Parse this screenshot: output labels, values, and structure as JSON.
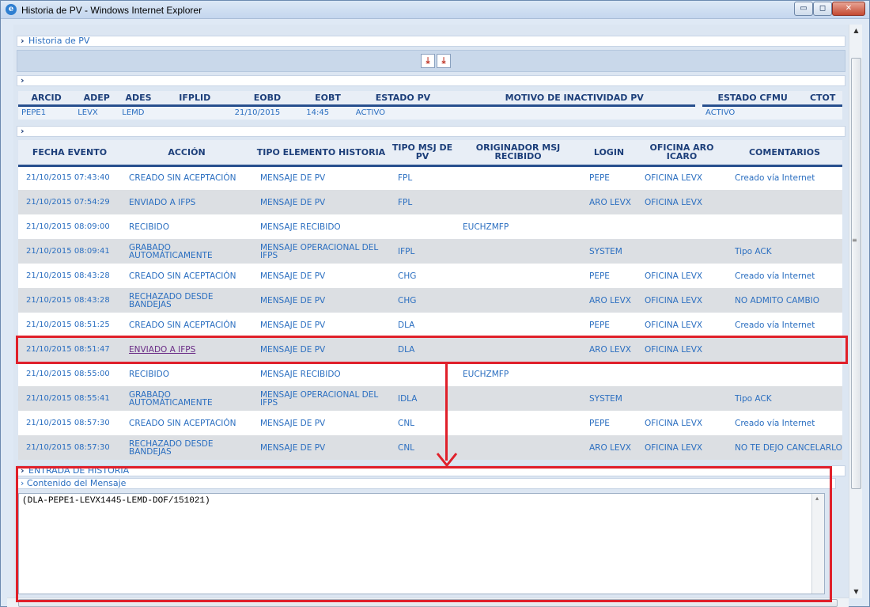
{
  "window": {
    "title": "Historia de PV - Windows Internet Explorer",
    "ie_icon": "ie-logo-icon",
    "controls": {
      "minimize": "▭",
      "maximize": "◻",
      "close": "✕"
    }
  },
  "sections": {
    "historia": "Historia de PV",
    "bullet": "›"
  },
  "pv": {
    "headers": [
      "ARCID",
      "ADEP",
      "ADES",
      "IFPLID",
      "EOBD",
      "EOBT",
      "ESTADO PV",
      "MOTIVO DE INACTIVIDAD PV",
      "ESTADO CFMU",
      "CTOT"
    ],
    "row": [
      "PEPE1",
      "LEVX",
      "LEMD",
      "",
      "21/10/2015",
      "14:45",
      "ACTIVO",
      "",
      "ACTIVO",
      ""
    ]
  },
  "history": {
    "headers": [
      "FECHA EVENTO",
      "ACCIÓN",
      "TIPO ELEMENTO HISTORIA",
      "TIPO MSJ DE PV",
      "ORIGINADOR MSJ RECIBIDO",
      "LOGIN",
      "OFICINA ARO ICARO",
      "COMENTARIOS"
    ],
    "rows": [
      [
        "21/10/2015 07:43:40",
        "CREADO SIN ACEPTACIÓN",
        "MENSAJE DE PV",
        "FPL",
        "",
        "PEPE",
        "OFICINA LEVX",
        "Creado vía Internet"
      ],
      [
        "21/10/2015 07:54:29",
        "ENVIADO A IFPS",
        "MENSAJE DE PV",
        "FPL",
        "",
        "ARO LEVX",
        "OFICINA LEVX",
        ""
      ],
      [
        "21/10/2015 08:09:00",
        "RECIBIDO",
        "MENSAJE RECIBIDO",
        "",
        "EUCHZMFP",
        "",
        "",
        ""
      ],
      [
        "21/10/2015 08:09:41",
        "GRABADO AUTOMÁTICAMENTE",
        "MENSAJE OPERACIONAL DEL IFPS",
        "IFPL",
        "",
        "SYSTEM",
        "",
        "Tipo ACK"
      ],
      [
        "21/10/2015 08:43:28",
        "CREADO SIN ACEPTACIÓN",
        "MENSAJE DE PV",
        "CHG",
        "",
        "PEPE",
        "OFICINA LEVX",
        "Creado vía Internet"
      ],
      [
        "21/10/2015 08:43:28",
        "RECHAZADO DESDE BANDEJAS",
        "MENSAJE DE PV",
        "CHG",
        "",
        "ARO LEVX",
        "OFICINA LEVX",
        "NO ADMITO CAMBIO"
      ],
      [
        "21/10/2015 08:51:25",
        "CREADO SIN ACEPTACIÓN",
        "MENSAJE DE PV",
        "DLA",
        "",
        "PEPE",
        "OFICINA LEVX",
        "Creado vía Internet"
      ],
      [
        "21/10/2015 08:51:47",
        "ENVIADO A IFPS",
        "MENSAJE DE PV",
        "DLA",
        "",
        "ARO LEVX",
        "OFICINA LEVX",
        ""
      ],
      [
        "21/10/2015 08:55:00",
        "RECIBIDO",
        "MENSAJE RECIBIDO",
        "",
        "EUCHZMFP",
        "",
        "",
        ""
      ],
      [
        "21/10/2015 08:55:41",
        "GRABADO AUTOMÁTICAMENTE",
        "MENSAJE OPERACIONAL DEL IFPS",
        "IDLA",
        "",
        "SYSTEM",
        "",
        "Tipo ACK"
      ],
      [
        "21/10/2015 08:57:30",
        "CREADO SIN ACEPTACIÓN",
        "MENSAJE DE PV",
        "CNL",
        "",
        "PEPE",
        "OFICINA LEVX",
        "Creado vía Internet"
      ],
      [
        "21/10/2015 08:57:30",
        "RECHAZADO DESDE BANDEJAS",
        "MENSAJE DE PV",
        "CNL",
        "",
        "ARO LEVX",
        "OFICINA LEVX",
        "NO TE DEJO CANCELARLO"
      ]
    ],
    "selected_row": 7
  },
  "entrada": {
    "title": "ENTRADA DE HISTORIA",
    "contenido_title": "Contenido del Mensaje",
    "message": "(DLA-PEPE1-LEVX1445-LEMD-DOF/151021)"
  },
  "colors": {
    "annotation_red": "#e0202a",
    "link_blue": "#2a6ec0",
    "header_navy": "#1d3f7a"
  }
}
